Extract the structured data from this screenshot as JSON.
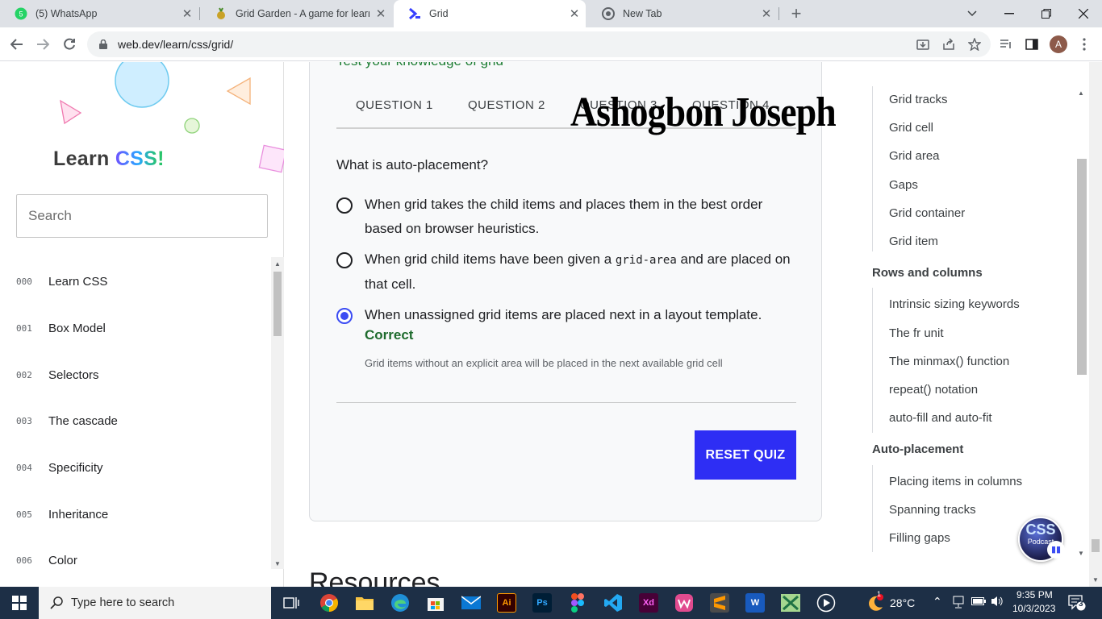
{
  "browser": {
    "tabs": [
      {
        "title": "(5) WhatsApp",
        "icon": "whatsapp-icon"
      },
      {
        "title": "Grid Garden - A game for learnin",
        "icon": "grid-garden-icon"
      },
      {
        "title": "Grid",
        "icon": "web-dev-icon",
        "active": true
      },
      {
        "title": "New Tab",
        "icon": "chrome-icon"
      }
    ],
    "url": "web.dev/learn/css/grid/",
    "profile_initial": "A"
  },
  "sidebar": {
    "logo_prefix": "Learn ",
    "logo_css": "CSS",
    "logo_suffix": "!",
    "search_placeholder": "Search",
    "items": [
      {
        "num": "000",
        "label": "Learn CSS"
      },
      {
        "num": "001",
        "label": "Box Model"
      },
      {
        "num": "002",
        "label": "Selectors"
      },
      {
        "num": "003",
        "label": "The cascade"
      },
      {
        "num": "004",
        "label": "Specificity"
      },
      {
        "num": "005",
        "label": "Inheritance"
      },
      {
        "num": "006",
        "label": "Color"
      }
    ]
  },
  "quiz": {
    "heading": "Test your knowledge of grid",
    "tabs": [
      "QUESTION 1",
      "QUESTION 2",
      "QUESTION 3",
      "QUESTION 4"
    ],
    "question": "What is auto-placement?",
    "options": [
      {
        "text": "When grid takes the child items and places them in the best order based on browser heuristics.",
        "checked": false
      },
      {
        "text_before": "When grid child items have been given a ",
        "code": "grid-area",
        "text_after": " and are placed on that cell.",
        "checked": false
      },
      {
        "text": "When unassigned grid items are placed next in a layout template.",
        "checked": true
      }
    ],
    "result": "Correct",
    "explanation": "Grid items without an explicit area will be placed in the next available grid cell",
    "reset_label": "RESET QUIZ"
  },
  "watermark": "Ashogbon Joseph",
  "resources_heading": "Resources",
  "toc": {
    "items_top": [
      "Grid tracks",
      "Grid cell",
      "Grid area",
      "Gaps",
      "Grid container",
      "Grid item"
    ],
    "section_rows": "Rows and columns",
    "items_rows": [
      "Intrinsic sizing keywords",
      "The fr unit",
      "The minmax() function",
      "repeat() notation",
      "auto-fill and auto-fit"
    ],
    "section_auto": "Auto-placement",
    "items_auto": [
      "Placing items in columns",
      "Spanning tracks",
      "Filling gaps"
    ]
  },
  "podcast": {
    "line1": "CSS",
    "line2": "Podcast"
  },
  "taskbar": {
    "search_placeholder": "Type here to search",
    "apps": [
      {
        "name": "task-view-icon",
        "label": ""
      },
      {
        "name": "chrome-icon",
        "label": ""
      },
      {
        "name": "file-explorer-icon",
        "label": ""
      },
      {
        "name": "edge-icon",
        "label": ""
      },
      {
        "name": "store-icon",
        "label": ""
      },
      {
        "name": "mail-icon",
        "label": ""
      },
      {
        "name": "illustrator-icon",
        "label": "Ai"
      },
      {
        "name": "photoshop-icon",
        "label": "Ps"
      },
      {
        "name": "figma-icon",
        "label": ""
      },
      {
        "name": "vscode-icon",
        "label": ""
      },
      {
        "name": "xd-icon",
        "label": "Xd"
      },
      {
        "name": "wps-icon",
        "label": ""
      },
      {
        "name": "sublime-icon",
        "label": ""
      },
      {
        "name": "word-icon",
        "label": "W"
      },
      {
        "name": "excel-icon",
        "label": ""
      },
      {
        "name": "media-player-icon",
        "label": ""
      }
    ],
    "weather": "28°C",
    "weather_badge": "1",
    "time": "9:35 PM",
    "date": "10/3/2023",
    "notification_count": "3"
  }
}
